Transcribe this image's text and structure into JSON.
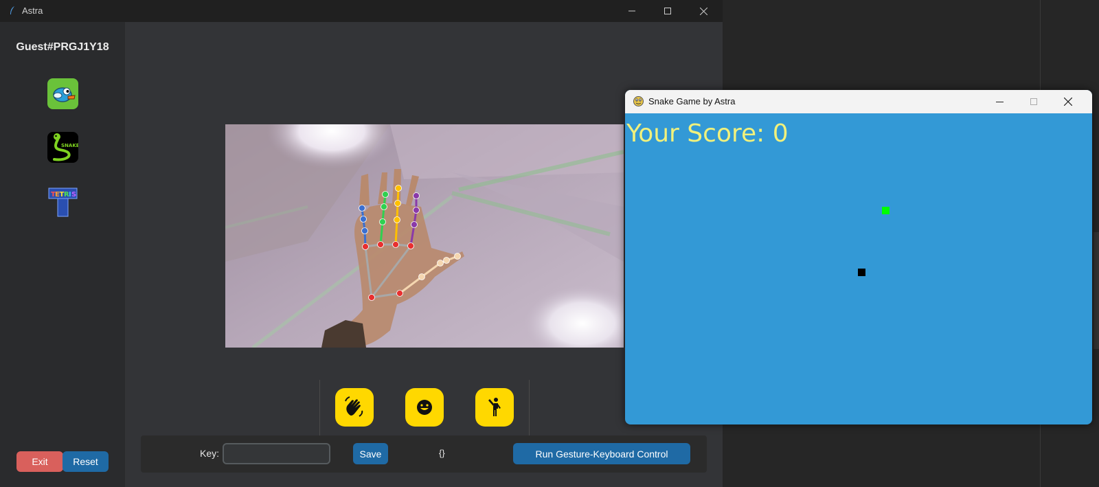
{
  "astra_window": {
    "title": "Astra",
    "sidebar": {
      "username": "Guest#PRGJ1Y18",
      "games": [
        {
          "name": "flappy-bird-icon",
          "color": "#6ac23a"
        },
        {
          "name": "snake-game-icon",
          "label": "SNAKE"
        },
        {
          "name": "tetris-icon",
          "label": "TETRIS"
        }
      ],
      "exit_label": "Exit",
      "reset_label": "Reset"
    },
    "gestures": [
      {
        "name": "wave-hand-icon"
      },
      {
        "name": "smiley-face-icon"
      },
      {
        "name": "person-gesture-icon"
      }
    ],
    "keybar": {
      "key_label": "Key:",
      "key_value": "",
      "save_label": "Save",
      "mapping_display": "{}",
      "run_label": "Run Gesture-Keyboard Control"
    }
  },
  "snake_window": {
    "title": "Snake Game by Astra",
    "score_text": "Your Score: 0"
  },
  "colors": {
    "accent_blue": "#1f6aa5",
    "exit_red": "#d9605c",
    "gesture_yellow": "#ffd800",
    "snake_bg": "#3399d6",
    "score_yellow": "#f1f17c",
    "food_green": "#00ff00"
  }
}
